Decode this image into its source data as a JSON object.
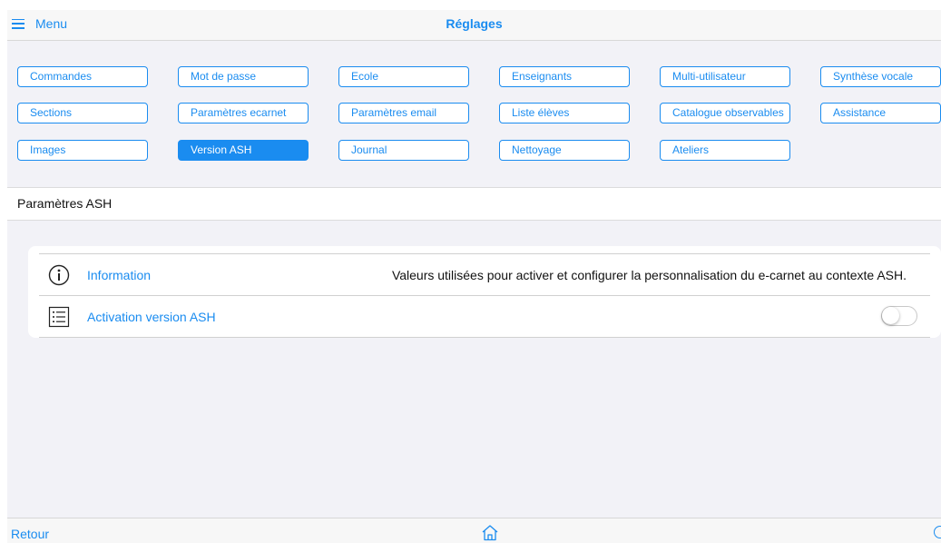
{
  "topbar": {
    "menu_label": "Menu",
    "title": "Réglages",
    "menu_icon": "hamburger-icon"
  },
  "tabs": [
    [
      "Commandes",
      "Mot de passe",
      "Ecole",
      "Enseignants",
      "Multi-utilisateur",
      "Synthèse vocale"
    ],
    [
      "Sections",
      "Paramètres ecarnet",
      "Paramètres email",
      "Liste élèves",
      "Catalogue observables",
      "Assistance"
    ],
    [
      "Images",
      "Version ASH",
      "Journal",
      "Nettoyage",
      "Ateliers"
    ]
  ],
  "active_tab": "Version ASH",
  "section": {
    "title": "Paramètres ASH"
  },
  "settings": {
    "information": {
      "icon": "info-icon",
      "label": "Information",
      "value": "Valeurs utilisées pour activer et configurer la personnalisation du e-carnet au contexte ASH."
    },
    "activation": {
      "icon": "list-icon",
      "label": "Activation version ASH",
      "toggle_on": false
    }
  },
  "bottombar": {
    "back_label": "Retour",
    "home_icon": "home-icon"
  },
  "colors": {
    "accent": "#1a8cf0",
    "background": "#f2f2f7"
  }
}
